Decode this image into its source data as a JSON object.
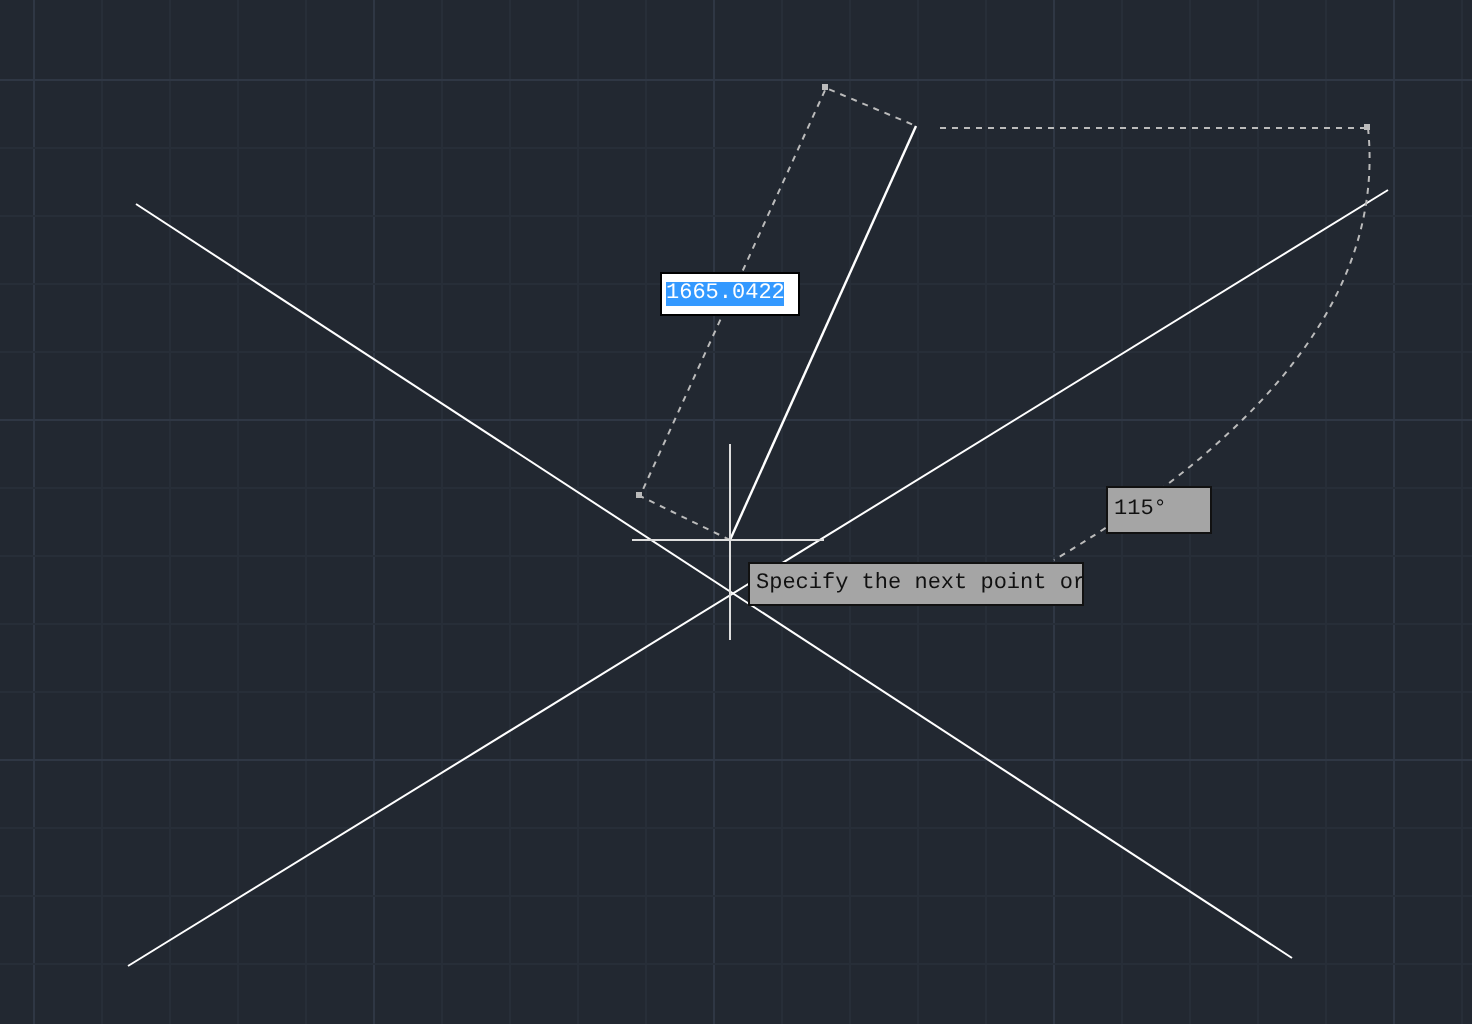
{
  "dimension_input": {
    "value": "1665.0422",
    "selected": true
  },
  "angle_readout": "115°",
  "prompt": "Specify the next point or"
}
